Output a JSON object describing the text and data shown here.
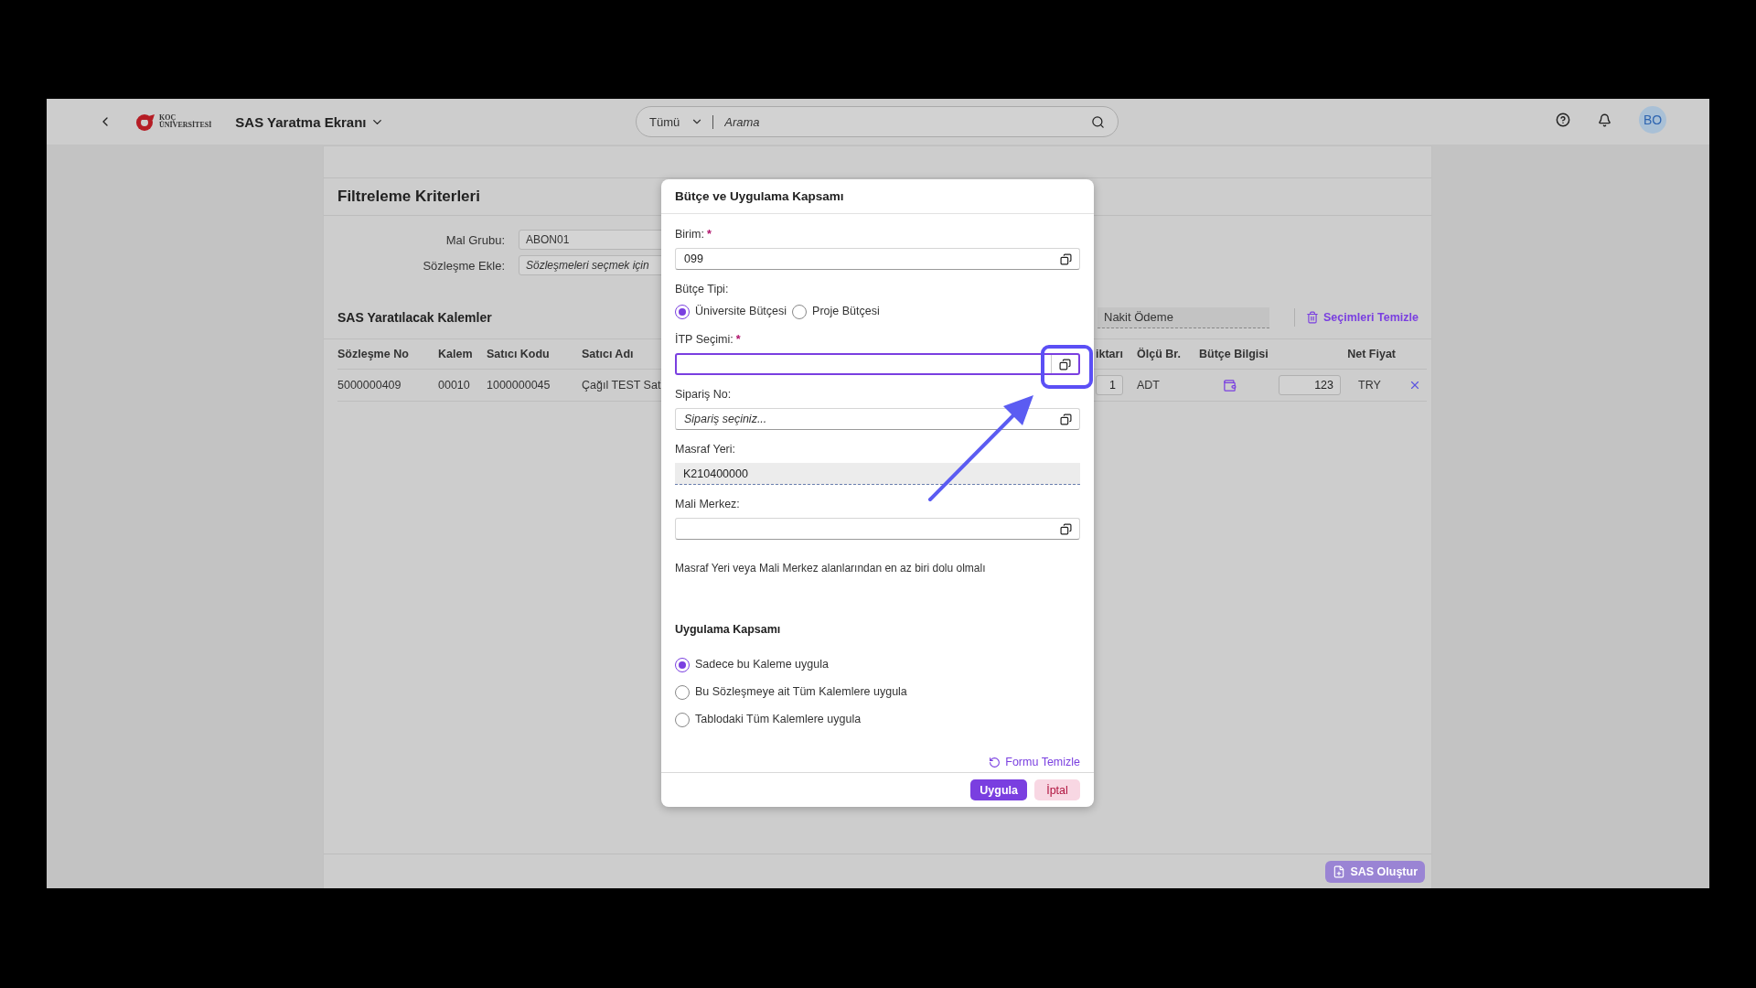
{
  "header": {
    "logo": {
      "line1": "KOÇ",
      "line2": "ÜNİVERSİTESİ"
    },
    "title": "SAS Yaratma Ekranı",
    "search": {
      "scope": "Tümü",
      "placeholder": "Arama"
    },
    "avatar": "BO"
  },
  "filter": {
    "title": "Filtreleme Kriterleri",
    "fields": [
      {
        "label": "Mal Grubu:",
        "value": "ABON01"
      },
      {
        "label": "Sözleşme Ekle:",
        "placeholder": "Sözleşmeleri seçmek için"
      }
    ]
  },
  "items": {
    "title": "SAS Yaratılacak Kalemler",
    "payment": "Nakit Ödeme",
    "clear_button": "Seçimleri Temizle",
    "columns_left": [
      "Sözleşme No",
      "Kalem",
      "Satıcı Kodu",
      "Satıcı Adı"
    ],
    "columns_right": [
      "iktarı",
      "Ölçü Br.",
      "Bütçe Bilgisi",
      "Net Fiyat"
    ],
    "rows": [
      {
        "contract_no": "5000000409",
        "item": "00010",
        "vendor_code": "1000000045",
        "vendor_name": "Çağıl TEST Sat",
        "quantity": "1",
        "unit": "ADT",
        "net_price": "123",
        "currency": "TRY"
      }
    ]
  },
  "footer": {
    "create_button": "SAS Oluştur",
    "disabled": true
  },
  "modal": {
    "title": "Bütçe ve Uygulama Kapsamı",
    "unit": {
      "label": "Birim:",
      "required_mark": "*",
      "value": "099"
    },
    "budget_type": {
      "label": "Bütçe Tipi:",
      "options": [
        {
          "label": "Üniversite Bütçesi",
          "selected": true
        },
        {
          "label": "Proje Bütçesi",
          "selected": false
        }
      ]
    },
    "itp": {
      "label": "İTP Seçimi:",
      "required_mark": "*",
      "focused": true
    },
    "order": {
      "label": "Sipariş No:",
      "placeholder": "Sipariş seçiniz..."
    },
    "cost_center": {
      "label": "Masraf Yeri:",
      "value": "K210400000"
    },
    "profit_center": {
      "label": "Mali Merkez:"
    },
    "note": "Masraf Yeri veya Mali Merkez alanlarından en az biri dolu olmalı",
    "scope": {
      "title": "Uygulama Kapsamı",
      "options": [
        {
          "label": "Sadece bu Kaleme uygula",
          "selected": true
        },
        {
          "label": "Bu Sözleşmeye ait Tüm Kalemlere uygula",
          "selected": false
        },
        {
          "label": "Tablodaki Tüm Kalemlere uygula",
          "selected": false
        }
      ]
    },
    "clear_button": "Formu Temizle",
    "apply_button": "Uygula",
    "cancel_button": "İptal"
  }
}
